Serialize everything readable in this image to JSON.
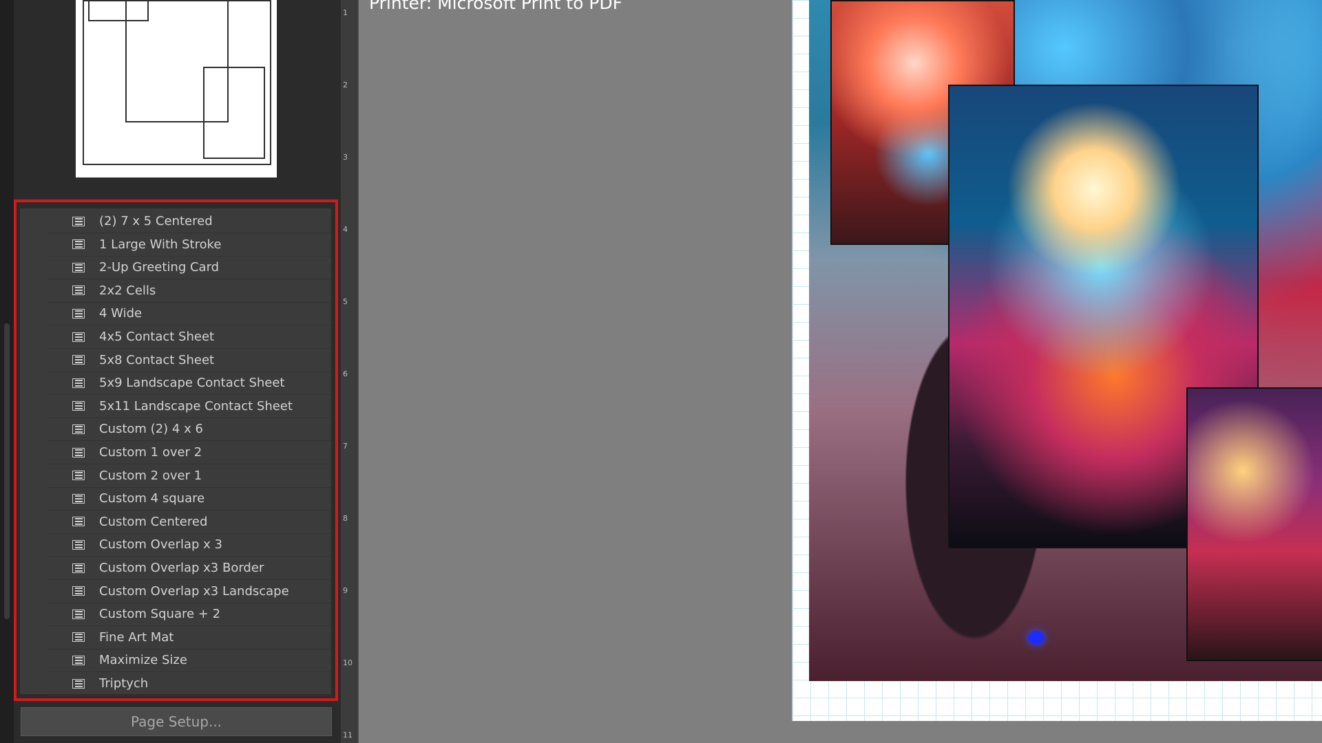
{
  "printer": {
    "label": "Printer:  Microsoft Print to PDF"
  },
  "ruler": {
    "marks": [
      "1",
      "2",
      "3",
      "4",
      "5",
      "6",
      "7",
      "8",
      "9",
      "10",
      "11"
    ]
  },
  "templates": [
    "(2) 7 x 5 Centered",
    "1 Large With Stroke",
    "2-Up Greeting Card",
    "2x2 Cells",
    "4 Wide",
    "4x5 Contact Sheet",
    "5x8 Contact Sheet",
    "5x9 Landscape Contact Sheet",
    "5x11 Landscape Contact Sheet",
    "Custom (2) 4 x 6",
    "Custom 1 over 2",
    "Custom 2 over 1",
    "Custom 4 square",
    "Custom Centered",
    "Custom Overlap x 3",
    "Custom Overlap x3 Border",
    "Custom Overlap x3 Landscape",
    "Custom Square + 2",
    "Fine Art Mat",
    "Maximize Size",
    "Triptych"
  ],
  "buttons": {
    "page_setup": "Page Setup..."
  },
  "colors": {
    "highlight": "#d11a1a",
    "panel": "#2b2b2b",
    "workspace": "#7f7f7f"
  }
}
